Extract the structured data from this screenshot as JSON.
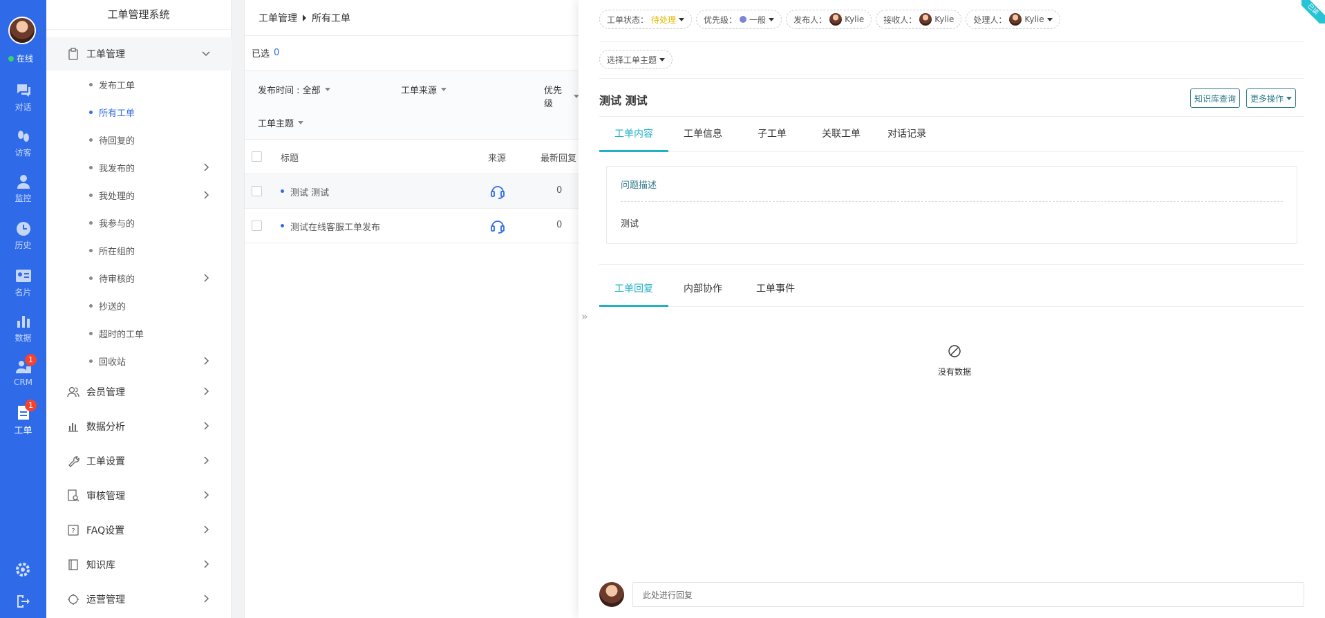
{
  "app": {
    "title": "工单管理系统"
  },
  "rail": {
    "status": "在线",
    "items": [
      {
        "label": "对话",
        "icon": "chat-icon"
      },
      {
        "label": "访客",
        "icon": "footprints-icon"
      },
      {
        "label": "监控",
        "icon": "monitor-user-icon"
      },
      {
        "label": "历史",
        "icon": "clock-icon"
      },
      {
        "label": "名片",
        "icon": "card-icon"
      },
      {
        "label": "数据",
        "icon": "bar-chart-icon"
      },
      {
        "label": "CRM",
        "icon": "crm-icon",
        "badge": "1"
      },
      {
        "label": "工单",
        "icon": "ticket-icon",
        "badge": "1",
        "active": true
      }
    ]
  },
  "menu": {
    "workorder_group": "工单管理",
    "sub_items": [
      {
        "label": "发布工单"
      },
      {
        "label": "所有工单"
      },
      {
        "label": "待回复的"
      },
      {
        "label": "我发布的"
      },
      {
        "label": "我处理的"
      },
      {
        "label": "我参与的"
      },
      {
        "label": "所在组的"
      },
      {
        "label": "待审核的"
      },
      {
        "label": "抄送的"
      },
      {
        "label": "超时的工单"
      },
      {
        "label": "回收站"
      }
    ],
    "groups": [
      {
        "label": "会员管理"
      },
      {
        "label": "数据分析"
      },
      {
        "label": "工单设置"
      },
      {
        "label": "审核管理"
      },
      {
        "label": "FAQ设置"
      },
      {
        "label": "知识库"
      },
      {
        "label": "运营管理"
      }
    ]
  },
  "list": {
    "breadcrumb": [
      "工单管理",
      "所有工单"
    ],
    "selected_label": "已选",
    "selected_count": "0",
    "filters": {
      "publish_time": "发布时间 : 全部",
      "source": "工单来源",
      "priority": "优先级",
      "topic": "工单主题"
    },
    "columns": [
      "标题",
      "来源",
      "最新回复"
    ],
    "rows": [
      {
        "title": "测试 测试",
        "replies": "0"
      },
      {
        "title": "测试在线客服工单发布",
        "replies": "0"
      }
    ]
  },
  "detail": {
    "corner_flag": "已读",
    "tags": {
      "status_label": "工单状态：",
      "status_value": "待处理",
      "priority_label": "优先级：",
      "priority_value": "一般",
      "publisher_label": "发布人：",
      "publisher": "Kylie",
      "receiver_label": "接收人：",
      "receiver": "Kylie",
      "handler_label": "处理人：",
      "handler": "Kylie"
    },
    "topic_select": "选择工单主题",
    "title": "测试 测试",
    "kb_button": "知识库查询",
    "more_button": "更多操作",
    "tabs": [
      "工单内容",
      "工单信息",
      "子工单",
      "关联工单",
      "对话记录"
    ],
    "desc_label": "问题描述",
    "desc_text": "测试",
    "bottom_tabs": [
      "工单回复",
      "内部协作",
      "工单事件"
    ],
    "empty_text": "没有数据",
    "reply_placeholder": "此处进行回复"
  }
}
